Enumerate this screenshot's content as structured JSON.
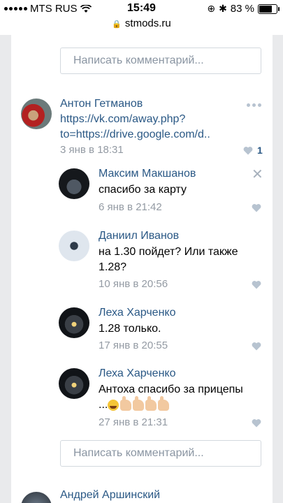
{
  "status": {
    "carrier": "MTS RUS",
    "time": "15:49",
    "battery": "83 %",
    "battery_level": 0.83,
    "url": "stmods.ru"
  },
  "input_top": {
    "placeholder": "Написать комментарий..."
  },
  "input_bottom": {
    "placeholder": "Написать комментарий..."
  },
  "main_comment": {
    "author": "Антон Гетманов",
    "link_line1": "https://vk.com/away.php?",
    "link_line2": "to=https://drive.google.com/d..",
    "date": "3 янв в 18:31",
    "likes": "1"
  },
  "replies": [
    {
      "author": "Максим Макшанов",
      "text": "спасибо за карту",
      "date": "6 янв в 21:42"
    },
    {
      "author": "Даниил Иванов",
      "text_line1": "на 1.30 пойдет? Или также",
      "text_line2": "1.28?",
      "date": "10 янв в 20:56"
    },
    {
      "author": "Леха Харченко",
      "text": "1.28 только.",
      "date": "17 янв в 20:55"
    },
    {
      "author": "Леха Харченко",
      "text_line1": "Антоха спасибо за прицепы",
      "text_line2": "...",
      "date": "27 янв в 21:31"
    }
  ],
  "next_comment": {
    "author": "Андрей Аршинский"
  },
  "colors": {
    "link": "#2a5885",
    "muted": "#939aa3",
    "background": "#e9eaec",
    "heart": "#b7c3d0"
  },
  "icons": {
    "wifi": "wifi-icon",
    "lock": "lock-icon",
    "like": "heart-icon",
    "more": "more-dots-icon",
    "close": "close-icon"
  }
}
